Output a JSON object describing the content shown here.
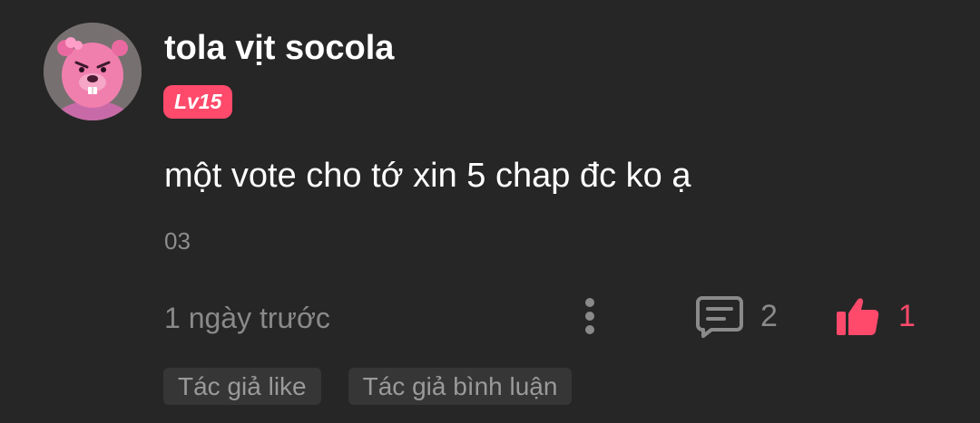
{
  "comment": {
    "username": "tola vịt socola",
    "level": "Lv15",
    "text": "một vote cho tớ xin 5 chap đc ko ạ",
    "meta": "03",
    "timestamp": "1 ngày trước",
    "reply_count": "2",
    "like_count": "1",
    "tags": [
      "Tác giả like",
      "Tác giả bình luận"
    ]
  },
  "icons": {
    "avatar": "pink-beaver-avatar",
    "more": "more-vertical-icon",
    "reply": "comment-bubble-icon",
    "like": "thumbs-up-icon"
  },
  "colors": {
    "background": "#262626",
    "accent": "#ff4a6b",
    "muted_text": "#8a8a8a",
    "tag_bg": "#363636"
  }
}
